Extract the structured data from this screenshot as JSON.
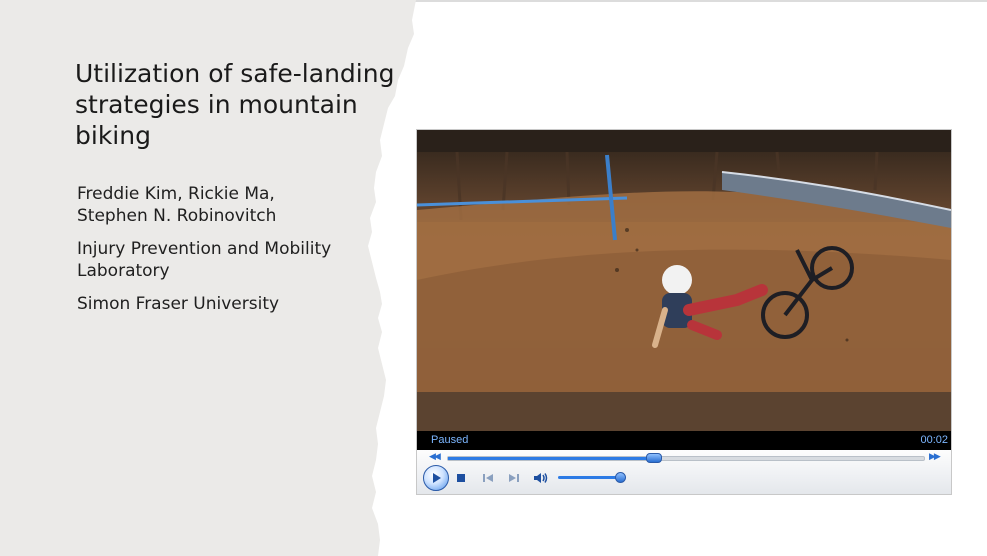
{
  "slide": {
    "title": "Utilization of safe-landing strategies in mountain biking",
    "authors_line1": "Freddie Kim, Rickie Ma,",
    "authors_line2": "Stephen N. Robinovitch",
    "lab_line1": "Injury Prevention and Mobility",
    "lab_line2": "Laboratory",
    "university": "Simon Fraser University"
  },
  "player": {
    "status": "Paused",
    "time": "00:02",
    "seek_progress": 0.43,
    "volume_level": 1.0,
    "icons": {
      "play": "play-icon",
      "stop": "stop-icon",
      "previous": "previous-track-icon",
      "next": "next-track-icon",
      "volume": "speaker-icon",
      "rewind": "rewind-icon",
      "fast_forward": "fast-forward-icon"
    },
    "colors": {
      "accent": "#2d7be5",
      "status_text": "#7cb6ff"
    }
  }
}
